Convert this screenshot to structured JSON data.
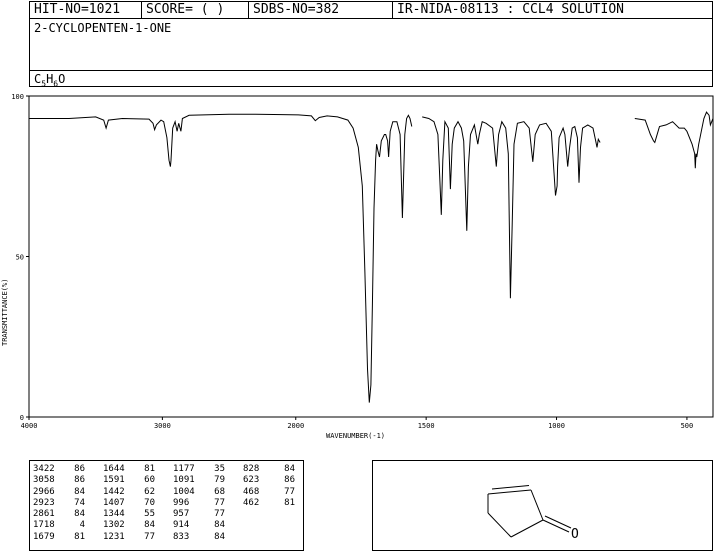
{
  "header": {
    "hit_no": "HIT-NO=1021",
    "score": "SCORE=  (   )",
    "sdbs_no": "SDBS-NO=382",
    "source": "IR-NIDA-08113 : CCL4 SOLUTION",
    "compound": "2-CYCLOPENTEN-1-ONE",
    "formula": {
      "c": "C",
      "c_n": "5",
      "h": "H",
      "h_n": "6",
      "o": "O"
    }
  },
  "chart_data": {
    "type": "line",
    "title": "",
    "xlabel": "WAVENUMBER(-1)",
    "ylabel": "TRANSMITTANCE(%)",
    "xlim": [
      4000,
      400
    ],
    "ylim": [
      0,
      100
    ],
    "x_ticks": [
      "4000",
      "3000",
      "2000",
      "1500",
      "1000",
      "500"
    ],
    "y_ticks": [
      "0",
      "50",
      "100"
    ],
    "series": [
      {
        "segments": [
          [
            [
              4000,
              93
            ],
            [
              3700,
              93
            ],
            [
              3500,
              93.5
            ],
            [
              3440,
              92.5
            ],
            [
              3422,
              90
            ],
            [
              3405,
              92.5
            ],
            [
              3300,
              93
            ],
            [
              3100,
              92.8
            ],
            [
              3070,
              91.5
            ],
            [
              3058,
              89.5
            ],
            [
              3045,
              91
            ],
            [
              3010,
              92.5
            ],
            [
              2990,
              92
            ],
            [
              2966,
              87
            ],
            [
              2950,
              80
            ],
            [
              2940,
              78
            ],
            [
              2935,
              80
            ],
            [
              2923,
              90
            ],
            [
              2905,
              92
            ],
            [
              2890,
              89
            ],
            [
              2878,
              91.5
            ],
            [
              2861,
              89
            ],
            [
              2850,
              93
            ],
            [
              2800,
              94
            ],
            [
              2500,
              94.3
            ],
            [
              2300,
              94.3
            ],
            [
              2100,
              94.2
            ],
            [
              1990,
              94.1
            ],
            [
              1940,
              93.8
            ],
            [
              1925,
              92.3
            ],
            [
              1910,
              93.3
            ],
            [
              1880,
              93.8
            ],
            [
              1840,
              93.5
            ],
            [
              1800,
              92.5
            ],
            [
              1780,
              90
            ],
            [
              1760,
              84
            ],
            [
              1745,
              72
            ],
            [
              1735,
              45
            ],
            [
              1725,
              15
            ],
            [
              1718,
              4.5
            ],
            [
              1712,
              10
            ],
            [
              1706,
              35
            ],
            [
              1700,
              65
            ],
            [
              1694,
              80
            ],
            [
              1690,
              85
            ],
            [
              1685,
              83
            ],
            [
              1679,
              81
            ],
            [
              1672,
              86
            ],
            [
              1660,
              88
            ],
            [
              1655,
              88
            ],
            [
              1648,
              86
            ],
            [
              1644,
              81
            ],
            [
              1638,
              89
            ],
            [
              1628,
              92
            ],
            [
              1612,
              92
            ],
            [
              1600,
              88
            ],
            [
              1591,
              62
            ],
            [
              1582,
              88
            ],
            [
              1575,
              93
            ],
            [
              1568,
              94
            ],
            [
              1562,
              93
            ],
            [
              1555,
              90.5
            ]
          ],
          [
            [
              1515,
              93.5
            ],
            [
              1490,
              93
            ],
            [
              1470,
              92
            ],
            [
              1455,
              88
            ],
            [
              1448,
              75
            ],
            [
              1442,
              63
            ],
            [
              1436,
              80
            ],
            [
              1428,
              92
            ],
            [
              1415,
              90
            ],
            [
              1407,
              71
            ],
            [
              1400,
              85
            ],
            [
              1392,
              90
            ],
            [
              1378,
              92
            ],
            [
              1365,
              90
            ],
            [
              1356,
              86
            ],
            [
              1344,
              58
            ],
            [
              1338,
              78
            ],
            [
              1330,
              88
            ],
            [
              1315,
              91
            ],
            [
              1302,
              85
            ],
            [
              1296,
              88
            ],
            [
              1285,
              92
            ],
            [
              1270,
              91.5
            ],
            [
              1245,
              90
            ],
            [
              1231,
              78
            ],
            [
              1222,
              88
            ],
            [
              1210,
              92
            ],
            [
              1195,
              90
            ],
            [
              1185,
              82
            ],
            [
              1177,
              37
            ],
            [
              1170,
              60
            ],
            [
              1163,
              85
            ],
            [
              1150,
              91.5
            ],
            [
              1125,
              92
            ],
            [
              1105,
              90
            ],
            [
              1091,
              79.5
            ],
            [
              1082,
              88
            ],
            [
              1065,
              91
            ],
            [
              1040,
              91.5
            ],
            [
              1020,
              89
            ],
            [
              1004,
              69
            ],
            [
              998,
              72
            ],
            [
              996,
              78
            ],
            [
              990,
              87
            ],
            [
              975,
              90
            ],
            [
              968,
              88
            ],
            [
              957,
              78
            ],
            [
              950,
              84
            ],
            [
              940,
              90
            ],
            [
              930,
              90.5
            ],
            [
              920,
              87
            ],
            [
              914,
              73
            ],
            [
              908,
              84
            ],
            [
              900,
              90
            ],
            [
              880,
              91
            ],
            [
              860,
              90
            ],
            [
              850,
              86
            ],
            [
              845,
              84
            ],
            [
              840,
              86.5
            ],
            [
              833,
              85.5
            ]
          ],
          [
            [
              700,
              93
            ],
            [
              660,
              92.5
            ],
            [
              640,
              88
            ],
            [
              628,
              86
            ],
            [
              623,
              85.5
            ],
            [
              618,
              87
            ],
            [
              605,
              90.5
            ],
            [
              580,
              91
            ],
            [
              555,
              92
            ],
            [
              530,
              90
            ],
            [
              510,
              90
            ],
            [
              500,
              89
            ],
            [
              480,
              85
            ],
            [
              470,
              82
            ],
            [
              468,
              77.5
            ],
            [
              465,
              82
            ],
            [
              462,
              81
            ],
            [
              455,
              85
            ],
            [
              445,
              89
            ],
            [
              435,
              93
            ],
            [
              425,
              95
            ],
            [
              415,
              94
            ],
            [
              410,
              91
            ],
            [
              405,
              92
            ],
            [
              400,
              93
            ]
          ]
        ]
      }
    ]
  },
  "peak_table": [
    [
      "3422",
      "86"
    ],
    [
      "3058",
      "86"
    ],
    [
      "2966",
      "84"
    ],
    [
      "2923",
      "74"
    ],
    [
      "2861",
      "84"
    ],
    [
      "1718",
      "4"
    ],
    [
      "1679",
      "81"
    ],
    [
      "1644",
      "81"
    ],
    [
      "1591",
      "60"
    ],
    [
      "1442",
      "62"
    ],
    [
      "1407",
      "70"
    ],
    [
      "1344",
      "55"
    ],
    [
      "1302",
      "84"
    ],
    [
      "1231",
      "77"
    ],
    [
      "1177",
      "35"
    ],
    [
      "1091",
      "79"
    ],
    [
      "1004",
      "68"
    ],
    [
      "996",
      "77"
    ],
    [
      "957",
      "77"
    ],
    [
      "914",
      "84"
    ],
    [
      "833",
      "84"
    ],
    [
      "828",
      "84"
    ],
    [
      "623",
      "86"
    ],
    [
      "468",
      "77"
    ],
    [
      "462",
      "81"
    ]
  ],
  "structure": {
    "atom_label": "O"
  }
}
